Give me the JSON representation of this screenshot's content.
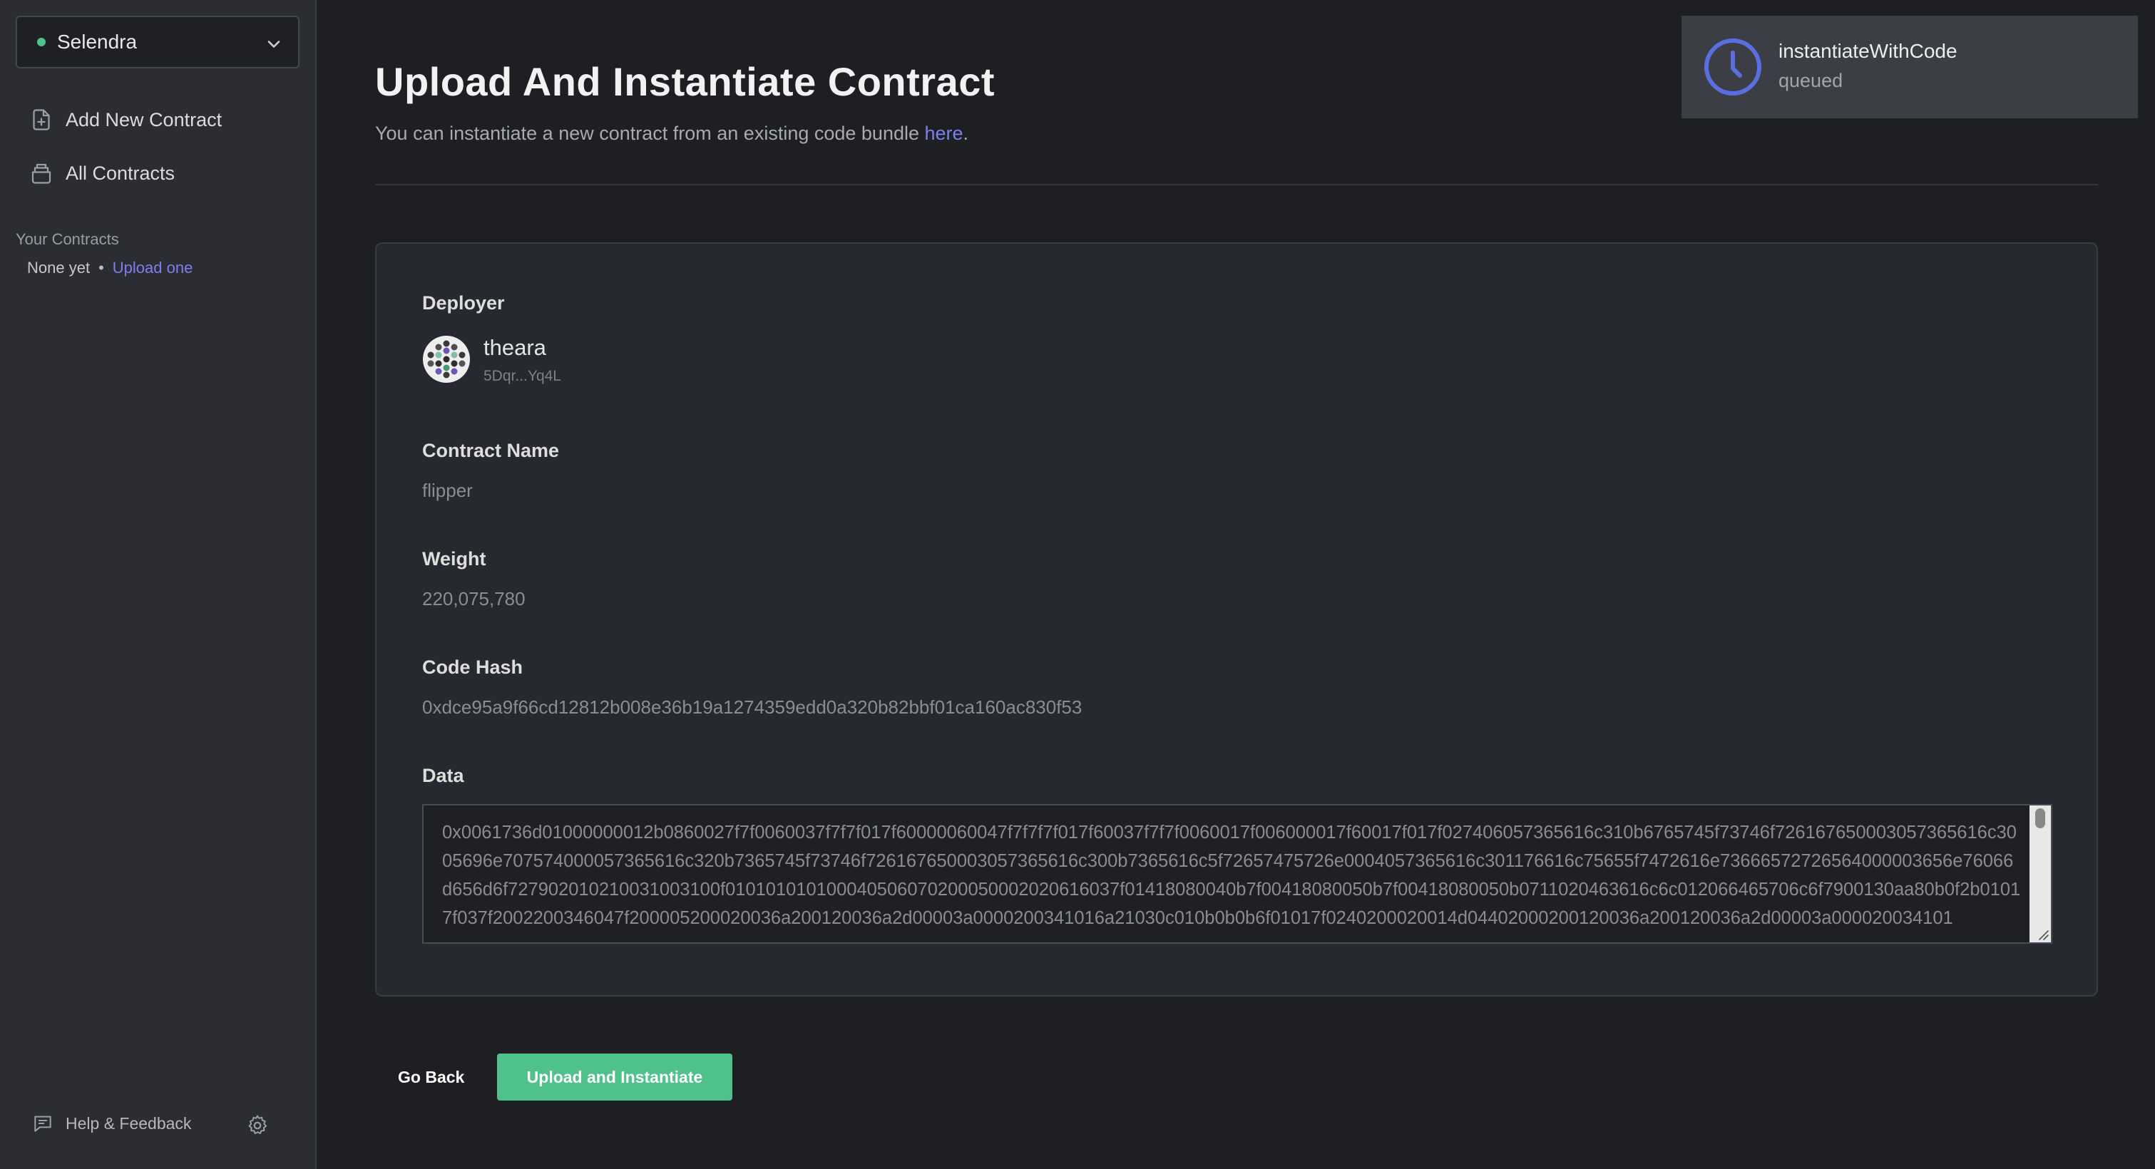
{
  "sidebar": {
    "chain": "Selendra",
    "nav": [
      {
        "label": "Add New Contract"
      },
      {
        "label": "All Contracts"
      }
    ],
    "your_contracts_heading": "Your Contracts",
    "none_yet": "None yet",
    "separator": "•",
    "upload_link": "Upload one",
    "help_label": "Help & Feedback"
  },
  "main": {
    "title": "Upload And Instantiate Contract",
    "subtitle": "You can instantiate a new contract from an existing code bundle ",
    "subtitle_link": "here",
    "subtitle_end": "."
  },
  "form": {
    "deployer_label": "Deployer",
    "account_name": "theara",
    "account_address": "5Dqr...Yq4L",
    "contract_name_label": "Contract Name",
    "contract_name": "flipper",
    "weight_label": "Weight",
    "weight": "220,075,780",
    "code_hash_label": "Code Hash",
    "code_hash": "0xdce95a9f66cd12812b008e36b19a1274359edd0a320b82bbf01ca160ac830f53",
    "data_label": "Data",
    "data": "0x0061736d01000000012b0860027f7f0060037f7f7f017f60000060047f7f7f7f017f60037f7f7f0060017f006000017f60017f017f027406057365616c310b6765745f73746f726167650003057365616c3005696e707574000057365616c320b7365745f73746f726167650003057365616c300b7365616c5f72657475726e0004057365616c301176616c75655f7472616e73666572726564000003656e76066d656d6f727902010210031003100f010101010100040506070200050002020616037f01418080040b7f00418080050b7f00418080050b0711020463616c6c012066465706c6f7900130aa80b0f2b01017f037f2002200346047f200005200020036a200120036a2d00003a0000200341016a21030c010b0b0b6f01017f0240200020014d04402000200120036a200120036a2d00003a000020034101"
  },
  "buttons": {
    "back": "Go Back",
    "upload": "Upload and Instantiate"
  },
  "toast": {
    "title": "instantiateWithCode",
    "status": "queued"
  },
  "colors": {
    "accent_green": "#4ec28a",
    "link_purple": "#7b7ff0",
    "status_blue": "#5b6ee1"
  }
}
